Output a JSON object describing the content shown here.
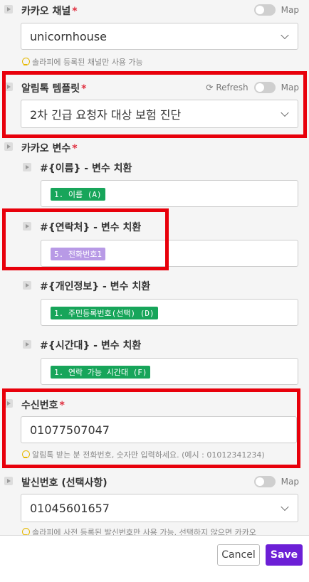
{
  "map_label": "Map",
  "kakao_channel": {
    "label": "카카오 채널",
    "required": "*",
    "value": "unicornhouse",
    "hint": "솔라피에 등록된 채널만 사용 가능"
  },
  "alimtalk_template": {
    "label": "알림톡 템플릿",
    "required": "*",
    "refresh": "Refresh",
    "value": "2차 긴급 요청자 대상 보험 진단"
  },
  "kakao_vars": {
    "label": "카카오 변수",
    "required": "*",
    "items": [
      {
        "label": "#{이름} - 변수 치환",
        "pill": "1. 이름 (A)",
        "pill_color": "#17a55a"
      },
      {
        "label": "#{연락처} - 변수 치환",
        "pill": "5. 전화번호1",
        "pill_color": "#b89ae6"
      },
      {
        "label": "#{개인정보} - 변수 치환",
        "pill": "1. 주민등록번호(선택) (D)",
        "pill_color": "#17a55a"
      },
      {
        "label": "#{시간대} - 변수 치환",
        "pill": "1. 연락 가능 시간대 (F)",
        "pill_color": "#17a55a"
      }
    ]
  },
  "recipient": {
    "label": "수신번호",
    "required": "*",
    "value": "01077507047",
    "hint": "알림톡 받는 분 전화번호, 숫자만 입력하세요. (예시 : 01012341234)"
  },
  "sender": {
    "label": "발신번호 (선택사항)",
    "value": "01045601657",
    "hint": "솔라피에 사전 등록된 발신번호만 사용 가능. 선택하지 않으면 카카오"
  },
  "footer": {
    "cancel": "Cancel",
    "save": "Save"
  },
  "colors": {
    "accent": "#6c1fd6",
    "highlight": "#e8000b",
    "pill_green": "#17a55a",
    "pill_purple": "#b89ae6"
  }
}
